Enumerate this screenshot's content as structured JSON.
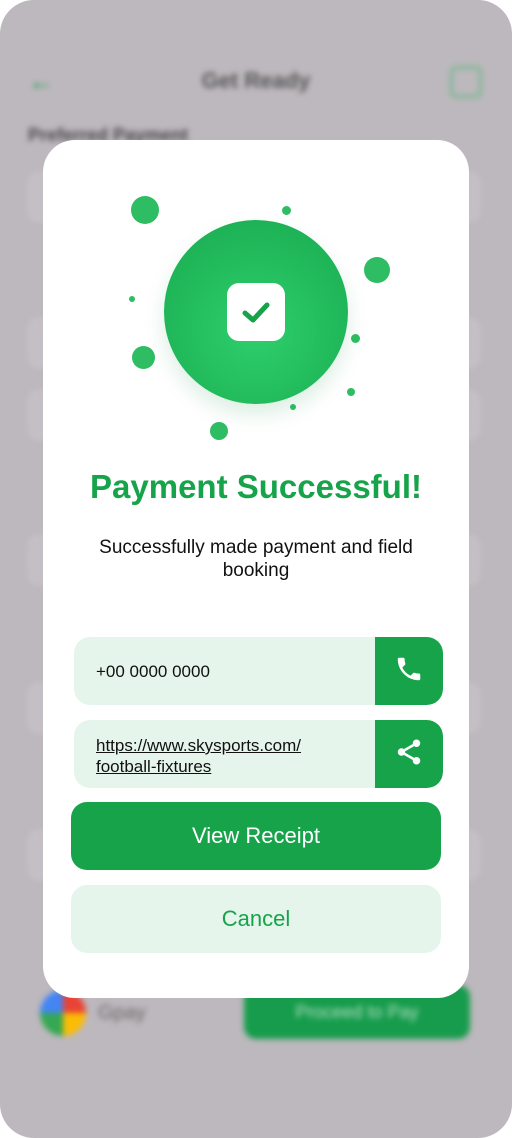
{
  "background_screen": {
    "title": "Get Ready",
    "section_label": "Preferred Payment",
    "payment_method": "Gpay",
    "proceed_button": "Proceed to Pay"
  },
  "modal": {
    "title": "Payment Successful!",
    "subtitle": "Successfully made payment and field booking",
    "phone": {
      "value": "+00 0000 0000",
      "icon": "phone-icon"
    },
    "link": {
      "line1": "https://www.skysports.com/",
      "line2": "football-fixtures",
      "icon": "share-icon"
    },
    "view_receipt_label": "View Receipt",
    "cancel_label": "Cancel",
    "success_icon": "checkmark-icon"
  },
  "colors": {
    "accent": "#16a34a",
    "accent_light": "#e6f5ec",
    "overlay": "#bdb8bd"
  }
}
